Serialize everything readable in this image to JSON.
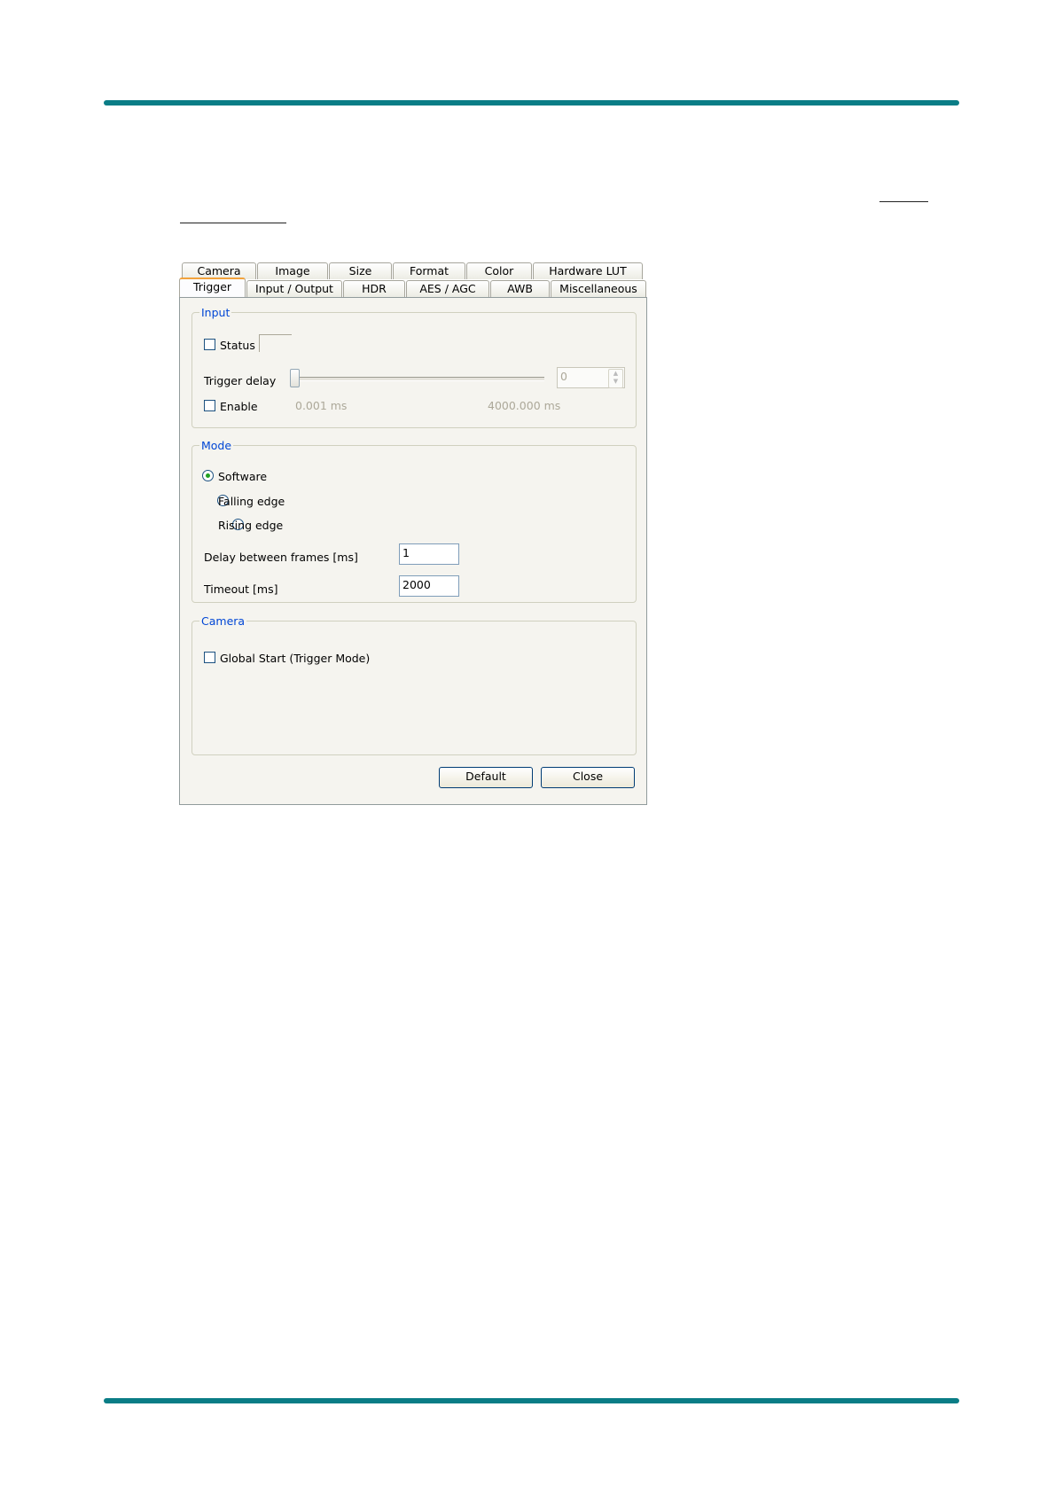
{
  "colors": {
    "rule": "#0a7d86",
    "group_title": "#0046d5",
    "active_tab_highlight": "#f2a33c",
    "radio_dot": "#21a121",
    "disabled_text": "#aca899"
  },
  "dialog": {
    "tabs_row1": [
      "Camera",
      "Image",
      "Size",
      "Format",
      "Color",
      "Hardware LUT"
    ],
    "tabs_row2": [
      "Trigger",
      "Input / Output",
      "HDR",
      "AES / AGC",
      "AWB",
      "Miscellaneous"
    ],
    "active_tab": "Trigger",
    "input_group": {
      "title": "Input",
      "status_label": "Status",
      "status_checked": false,
      "trigger_delay_label": "Trigger delay",
      "slider_level": 0,
      "min_label": "0.001 ms",
      "max_label": "4000.000 ms",
      "spin_value": "0",
      "enable_label": "Enable",
      "enable_checked": false
    },
    "mode_group": {
      "title": "Mode",
      "options": [
        "Software",
        "Falling edge",
        "Rising edge"
      ],
      "selected": "Software",
      "delay_label": "Delay between frames [ms]",
      "delay_value": "1",
      "timeout_label": "Timeout [ms]",
      "timeout_value": "2000"
    },
    "camera_group": {
      "title": "Camera",
      "global_start_label": "Global Start (Trigger Mode)",
      "global_start_checked": false
    },
    "buttons": {
      "default_label": "Default",
      "close_label": "Close"
    }
  }
}
